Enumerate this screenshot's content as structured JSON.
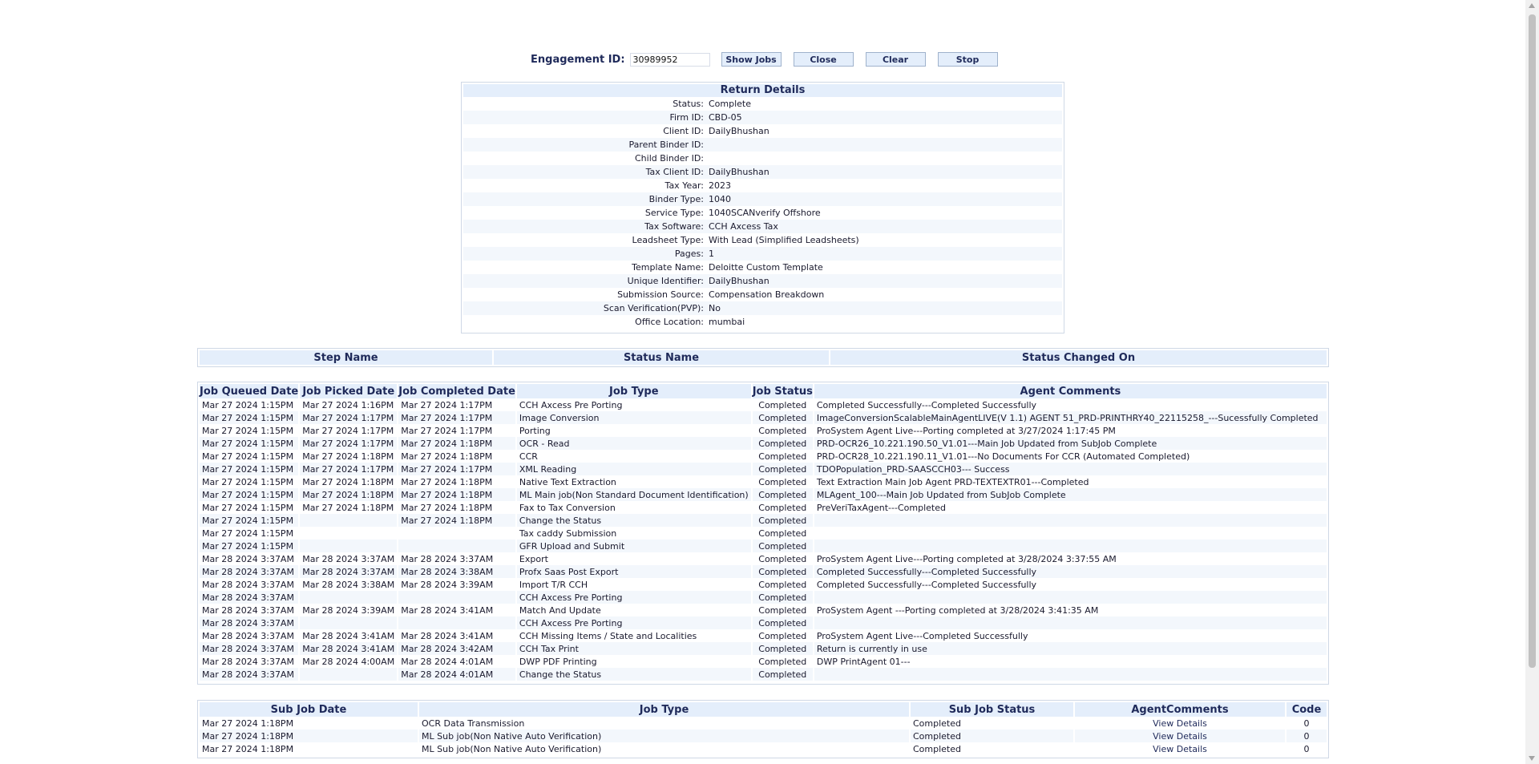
{
  "toolbar": {
    "engagement_label": "Engagement ID:",
    "engagement_value": "30989952",
    "show_jobs": "Show Jobs",
    "close": "Close",
    "clear": "Clear",
    "stop": "Stop"
  },
  "return_details": {
    "title": "Return Details",
    "rows": [
      {
        "k": "Status:",
        "v": "Complete"
      },
      {
        "k": "Firm ID:",
        "v": "CBD-05"
      },
      {
        "k": "Client ID:",
        "v": "DailyBhushan"
      },
      {
        "k": "Parent Binder ID:",
        "v": ""
      },
      {
        "k": "Child Binder ID:",
        "v": ""
      },
      {
        "k": "Tax Client ID:",
        "v": "DailyBhushan"
      },
      {
        "k": "Tax Year:",
        "v": "2023"
      },
      {
        "k": "Binder Type:",
        "v": "1040"
      },
      {
        "k": "Service Type:",
        "v": "1040SCANverify Offshore"
      },
      {
        "k": "Tax Software:",
        "v": "CCH Axcess Tax"
      },
      {
        "k": "Leadsheet Type:",
        "v": "With Lead (Simplified Leadsheets)"
      },
      {
        "k": "Pages:",
        "v": "1"
      },
      {
        "k": "Template Name:",
        "v": "Deloitte Custom Template"
      },
      {
        "k": "Unique Identifier:",
        "v": "DailyBhushan"
      },
      {
        "k": "Submission Source:",
        "v": "Compensation Breakdown"
      },
      {
        "k": "Scan Verification(PVP):",
        "v": "No"
      },
      {
        "k": "Office Location:",
        "v": "mumbai"
      }
    ]
  },
  "steps": {
    "headers": [
      "Step Name",
      "Status Name",
      "Status Changed On"
    ]
  },
  "jobs": {
    "headers": [
      "Job Queued Date",
      "Job Picked Date",
      "Job Completed Date",
      "Job Type",
      "Job Status",
      "Agent Comments"
    ],
    "rows": [
      [
        "Mar 27 2024 1:15PM",
        "Mar 27 2024 1:16PM",
        "Mar 27 2024 1:17PM",
        "CCH Axcess Pre Porting",
        "Completed",
        "Completed Successfully---Completed Successfully"
      ],
      [
        "Mar 27 2024 1:15PM",
        "Mar 27 2024 1:17PM",
        "Mar 27 2024 1:17PM",
        "Image Conversion",
        "Completed",
        "ImageConversionScalableMainAgentLIVE(V 1.1) AGENT 51_PRD-PRINTHRY40_22115258_---Sucessfully Completed"
      ],
      [
        "Mar 27 2024 1:15PM",
        "Mar 27 2024 1:17PM",
        "Mar 27 2024 1:17PM",
        "Porting",
        "Completed",
        "ProSystem Agent Live---Porting completed at 3/27/2024 1:17:45 PM"
      ],
      [
        "Mar 27 2024 1:15PM",
        "Mar 27 2024 1:17PM",
        "Mar 27 2024 1:18PM",
        "OCR - Read",
        "Completed",
        "PRD-OCR26_10.221.190.50_V1.01---Main Job Updated from SubJob Complete"
      ],
      [
        "Mar 27 2024 1:15PM",
        "Mar 27 2024 1:18PM",
        "Mar 27 2024 1:18PM",
        "CCR",
        "Completed",
        "PRD-OCR28_10.221.190.11_V1.01---No Documents For CCR (Automated Completed)"
      ],
      [
        "Mar 27 2024 1:15PM",
        "Mar 27 2024 1:17PM",
        "Mar 27 2024 1:17PM",
        "XML Reading",
        "Completed",
        "TDOPopulation_PRD-SAASCCH03--- Success"
      ],
      [
        "Mar 27 2024 1:15PM",
        "Mar 27 2024 1:18PM",
        "Mar 27 2024 1:18PM",
        "Native Text Extraction",
        "Completed",
        "Text Extraction Main Job Agent PRD-TEXTEXTR01---Completed"
      ],
      [
        "Mar 27 2024 1:15PM",
        "Mar 27 2024 1:18PM",
        "Mar 27 2024 1:18PM",
        "ML Main job(Non Standard Document Identification)",
        "Completed",
        "MLAgent_100---Main Job Updated from SubJob Complete"
      ],
      [
        "Mar 27 2024 1:15PM",
        "Mar 27 2024 1:18PM",
        "Mar 27 2024 1:18PM",
        "Fax to Tax Conversion",
        "Completed",
        "PreVeriTaxAgent---Completed"
      ],
      [
        "Mar 27 2024 1:15PM",
        "",
        "Mar 27 2024 1:18PM",
        "Change the Status",
        "Completed",
        ""
      ],
      [
        "Mar 27 2024 1:15PM",
        "",
        "",
        "Tax caddy Submission",
        "Completed",
        ""
      ],
      [
        "Mar 27 2024 1:15PM",
        "",
        "",
        "GFR Upload and Submit",
        "Completed",
        ""
      ],
      [
        "Mar 28 2024 3:37AM",
        "Mar 28 2024 3:37AM",
        "Mar 28 2024 3:37AM",
        "Export",
        "Completed",
        "ProSystem Agent Live---Porting completed at 3/28/2024 3:37:55 AM"
      ],
      [
        "Mar 28 2024 3:37AM",
        "Mar 28 2024 3:37AM",
        "Mar 28 2024 3:38AM",
        "Profx Saas Post Export",
        "Completed",
        "Completed Successfully---Completed Successfully"
      ],
      [
        "Mar 28 2024 3:37AM",
        "Mar 28 2024 3:38AM",
        "Mar 28 2024 3:39AM",
        "Import T/R CCH",
        "Completed",
        "Completed Successfully---Completed Successfully"
      ],
      [
        "Mar 28 2024 3:37AM",
        "",
        "",
        "CCH Axcess Pre Porting",
        "Completed",
        ""
      ],
      [
        "Mar 28 2024 3:37AM",
        "Mar 28 2024 3:39AM",
        "Mar 28 2024 3:41AM",
        "Match And Update",
        "Completed",
        "ProSystem Agent ---Porting completed at 3/28/2024 3:41:35 AM"
      ],
      [
        "Mar 28 2024 3:37AM",
        "",
        "",
        "CCH Axcess Pre Porting",
        "Completed",
        ""
      ],
      [
        "Mar 28 2024 3:37AM",
        "Mar 28 2024 3:41AM",
        "Mar 28 2024 3:41AM",
        "CCH Missing Items / State and Localities",
        "Completed",
        "ProSystem Agent Live---Completed Successfully"
      ],
      [
        "Mar 28 2024 3:37AM",
        "Mar 28 2024 3:41AM",
        "Mar 28 2024 3:42AM",
        "CCH Tax Print",
        "Completed",
        "Return is currently in use"
      ],
      [
        "Mar 28 2024 3:37AM",
        "Mar 28 2024 4:00AM",
        "Mar 28 2024 4:01AM",
        "DWP PDF Printing",
        "Completed",
        "DWP PrintAgent 01---"
      ],
      [
        "Mar 28 2024 3:37AM",
        "",
        "Mar 28 2024 4:01AM",
        "Change the Status",
        "Completed",
        ""
      ]
    ]
  },
  "subjobs": {
    "headers": [
      "Sub Job Date",
      "Job Type",
      "Sub Job Status",
      "AgentComments",
      "Code"
    ],
    "rows": [
      [
        "Mar 27 2024 1:18PM",
        "OCR Data Transmission",
        "Completed",
        "View Details",
        "0"
      ],
      [
        "Mar 27 2024 1:18PM",
        "ML Sub job(Non Native Auto Verification)",
        "Completed",
        "View Details",
        "0"
      ],
      [
        "Mar 27 2024 1:18PM",
        "ML Sub job(Non Native Auto Verification)",
        "Completed",
        "View Details",
        "0"
      ]
    ]
  }
}
